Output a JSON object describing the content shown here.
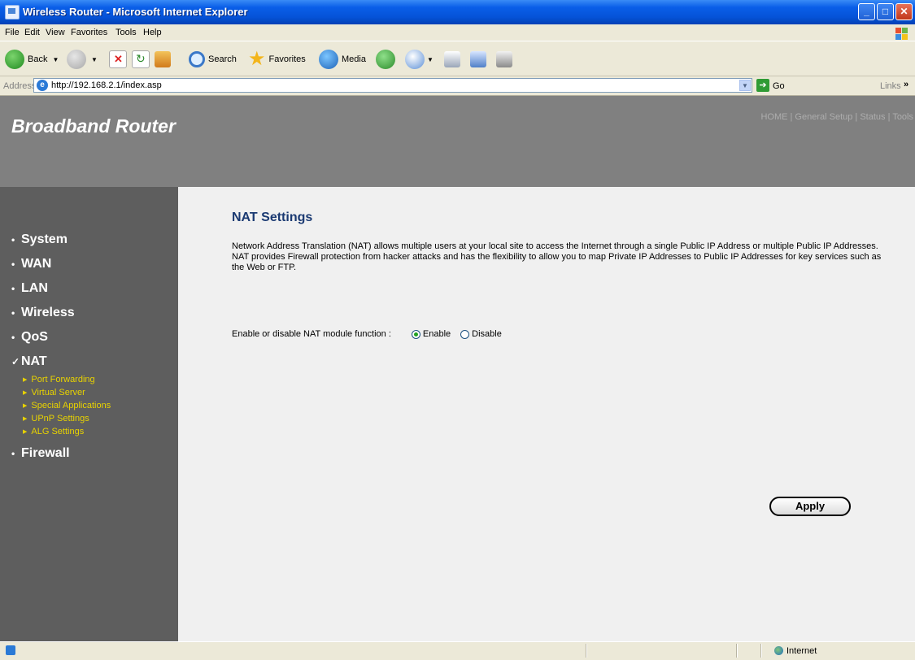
{
  "window": {
    "title": "Wireless Router - Microsoft Internet Explorer",
    "minimize_label": "_",
    "maximize_label": "□",
    "close_label": "✕"
  },
  "menu": [
    "File",
    "Edit",
    "View",
    "Favorites",
    "Tools",
    "Help"
  ],
  "toolbar": {
    "back_label": "Back",
    "search_label": "Search",
    "favorites_label": "Favorites",
    "media_label": "Media",
    "icons": [
      "back-icon",
      "forward-icon",
      "stop-icon",
      "refresh-icon",
      "home-icon",
      "search-icon",
      "favorites-icon",
      "media-icon",
      "history-icon",
      "mail-icon",
      "print-icon",
      "edit-icon",
      "messenger-icon"
    ]
  },
  "address_bar": {
    "label": "Address",
    "url": "http://192.168.2.1/index.asp",
    "go_label": "Go",
    "links_label": "Links",
    "more_label": "»"
  },
  "header": {
    "brand": "Broadband Router",
    "nav": [
      "HOME",
      "General Setup",
      "Status",
      "Tools"
    ],
    "separator": "|"
  },
  "sidebar": {
    "items": [
      {
        "marker": "•",
        "label": "System"
      },
      {
        "marker": "•",
        "label": "WAN"
      },
      {
        "marker": "•",
        "label": "LAN"
      },
      {
        "marker": "•",
        "label": "Wireless"
      },
      {
        "marker": "•",
        "label": "QoS"
      },
      {
        "marker": "✓",
        "label": "NAT"
      },
      {
        "marker": "•",
        "label": "Firewall"
      }
    ],
    "subitems": [
      "Port Forwarding",
      "Virtual Server",
      "Special Applications",
      "UPnP Settings",
      "ALG Settings"
    ],
    "submarker": "▶"
  },
  "main": {
    "title": "NAT Settings",
    "description": "Network Address Translation (NAT) allows multiple users at your local site to access the Internet through a single Public IP Address or multiple Public IP Addresses. NAT provides Firewall protection from hacker attacks and has the flexibility to allow you to map Private IP Addresses to Public IP Addresses for key services such as the Web or FTP.",
    "nat_label": "Enable or disable NAT module function :",
    "enable_label": "Enable",
    "disable_label": "Disable",
    "selected": "Enable",
    "apply_label": "Apply"
  },
  "statusbar": {
    "zone": "Internet"
  },
  "colors": {
    "titlebar": "#0553d8",
    "header": "#808080",
    "sidebar": "#5e5e5e",
    "subitem": "#e8d200",
    "title": "#1b3a72",
    "content_bg": "#f0f0f0"
  }
}
